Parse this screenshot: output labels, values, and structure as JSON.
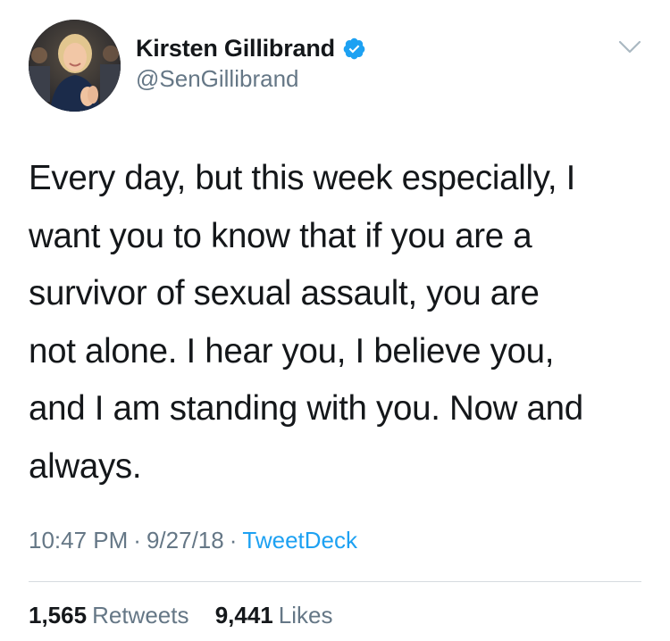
{
  "author": {
    "display_name": "Kirsten Gillibrand",
    "handle": "@SenGillibrand",
    "verified": true,
    "avatar_icon": "profile-photo"
  },
  "tweet": {
    "text_lines": [
      "Every day, but this week especially, I",
      "want you to know that if you are a",
      "survivor of sexual assault, you are",
      "not alone. I hear you, I believe you,",
      "and I am standing with you. Now and",
      "always."
    ],
    "time": "10:47 PM",
    "date": "9/27/18",
    "separator": "·",
    "source": "TweetDeck"
  },
  "stats": {
    "retweets_count": "1,565",
    "retweets_label": "Retweets",
    "likes_count": "9,441",
    "likes_label": "Likes"
  },
  "colors": {
    "text": "#14171a",
    "secondary": "#657786",
    "link": "#1da1f2",
    "verified_badge": "#1da1f2"
  }
}
